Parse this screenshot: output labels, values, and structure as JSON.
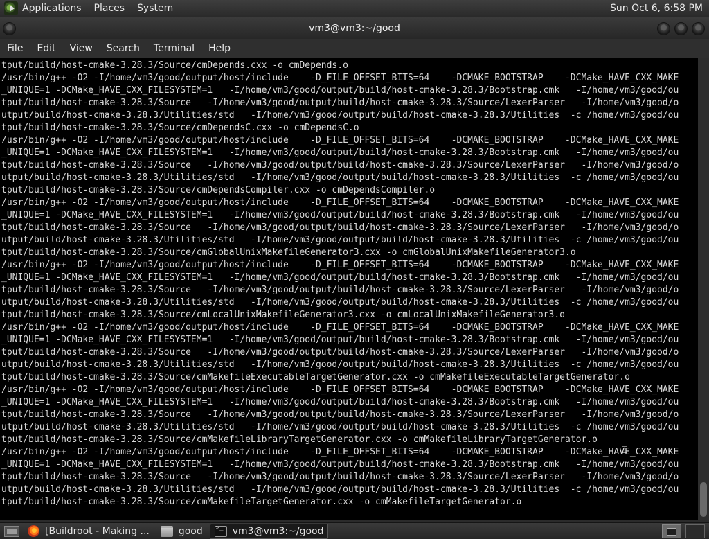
{
  "top_panel": {
    "menus": [
      "Applications",
      "Places",
      "System"
    ],
    "clock": "Sun Oct  6,  6:58 PM"
  },
  "window": {
    "title": "vm3@vm3:~/good"
  },
  "menubar": {
    "items": [
      "File",
      "Edit",
      "View",
      "Search",
      "Terminal",
      "Help"
    ]
  },
  "terminal": {
    "lines": [
      "tput/build/host-cmake-3.28.3/Source/cmDepends.cxx -o cmDepends.o",
      "/usr/bin/g++ -O2 -I/home/vm3/good/output/host/include    -D_FILE_OFFSET_BITS=64    -DCMAKE_BOOTSTRAP    -DCMake_HAVE_CXX_MAKE",
      "_UNIQUE=1 -DCMake_HAVE_CXX_FILESYSTEM=1   -I/home/vm3/good/output/build/host-cmake-3.28.3/Bootstrap.cmk   -I/home/vm3/good/ou",
      "tput/build/host-cmake-3.28.3/Source   -I/home/vm3/good/output/build/host-cmake-3.28.3/Source/LexerParser   -I/home/vm3/good/o",
      "utput/build/host-cmake-3.28.3/Utilities/std   -I/home/vm3/good/output/build/host-cmake-3.28.3/Utilities  -c /home/vm3/good/ou",
      "tput/build/host-cmake-3.28.3/Source/cmDependsC.cxx -o cmDependsC.o",
      "/usr/bin/g++ -O2 -I/home/vm3/good/output/host/include    -D_FILE_OFFSET_BITS=64    -DCMAKE_BOOTSTRAP    -DCMake_HAVE_CXX_MAKE",
      "_UNIQUE=1 -DCMake_HAVE_CXX_FILESYSTEM=1   -I/home/vm3/good/output/build/host-cmake-3.28.3/Bootstrap.cmk   -I/home/vm3/good/ou",
      "tput/build/host-cmake-3.28.3/Source   -I/home/vm3/good/output/build/host-cmake-3.28.3/Source/LexerParser   -I/home/vm3/good/o",
      "utput/build/host-cmake-3.28.3/Utilities/std   -I/home/vm3/good/output/build/host-cmake-3.28.3/Utilities  -c /home/vm3/good/ou",
      "tput/build/host-cmake-3.28.3/Source/cmDependsCompiler.cxx -o cmDependsCompiler.o",
      "/usr/bin/g++ -O2 -I/home/vm3/good/output/host/include    -D_FILE_OFFSET_BITS=64    -DCMAKE_BOOTSTRAP    -DCMake_HAVE_CXX_MAKE",
      "_UNIQUE=1 -DCMake_HAVE_CXX_FILESYSTEM=1   -I/home/vm3/good/output/build/host-cmake-3.28.3/Bootstrap.cmk   -I/home/vm3/good/ou",
      "tput/build/host-cmake-3.28.3/Source   -I/home/vm3/good/output/build/host-cmake-3.28.3/Source/LexerParser   -I/home/vm3/good/o",
      "utput/build/host-cmake-3.28.3/Utilities/std   -I/home/vm3/good/output/build/host-cmake-3.28.3/Utilities  -c /home/vm3/good/ou",
      "tput/build/host-cmake-3.28.3/Source/cmGlobalUnixMakefileGenerator3.cxx -o cmGlobalUnixMakefileGenerator3.o",
      "/usr/bin/g++ -O2 -I/home/vm3/good/output/host/include    -D_FILE_OFFSET_BITS=64    -DCMAKE_BOOTSTRAP    -DCMake_HAVE_CXX_MAKE",
      "_UNIQUE=1 -DCMake_HAVE_CXX_FILESYSTEM=1   -I/home/vm3/good/output/build/host-cmake-3.28.3/Bootstrap.cmk   -I/home/vm3/good/ou",
      "tput/build/host-cmake-3.28.3/Source   -I/home/vm3/good/output/build/host-cmake-3.28.3/Source/LexerParser   -I/home/vm3/good/o",
      "utput/build/host-cmake-3.28.3/Utilities/std   -I/home/vm3/good/output/build/host-cmake-3.28.3/Utilities  -c /home/vm3/good/ou",
      "tput/build/host-cmake-3.28.3/Source/cmLocalUnixMakefileGenerator3.cxx -o cmLocalUnixMakefileGenerator3.o",
      "/usr/bin/g++ -O2 -I/home/vm3/good/output/host/include    -D_FILE_OFFSET_BITS=64    -DCMAKE_BOOTSTRAP    -DCMake_HAVE_CXX_MAKE",
      "_UNIQUE=1 -DCMake_HAVE_CXX_FILESYSTEM=1   -I/home/vm3/good/output/build/host-cmake-3.28.3/Bootstrap.cmk   -I/home/vm3/good/ou",
      "tput/build/host-cmake-3.28.3/Source   -I/home/vm3/good/output/build/host-cmake-3.28.3/Source/LexerParser   -I/home/vm3/good/o",
      "utput/build/host-cmake-3.28.3/Utilities/std   -I/home/vm3/good/output/build/host-cmake-3.28.3/Utilities  -c /home/vm3/good/ou",
      "tput/build/host-cmake-3.28.3/Source/cmMakefileExecutableTargetGenerator.cxx -o cmMakefileExecutableTargetGenerator.o",
      "/usr/bin/g++ -O2 -I/home/vm3/good/output/host/include    -D_FILE_OFFSET_BITS=64    -DCMAKE_BOOTSTRAP    -DCMake_HAVE_CXX_MAKE",
      "_UNIQUE=1 -DCMake_HAVE_CXX_FILESYSTEM=1   -I/home/vm3/good/output/build/host-cmake-3.28.3/Bootstrap.cmk   -I/home/vm3/good/ou",
      "tput/build/host-cmake-3.28.3/Source   -I/home/vm3/good/output/build/host-cmake-3.28.3/Source/LexerParser   -I/home/vm3/good/o",
      "utput/build/host-cmake-3.28.3/Utilities/std   -I/home/vm3/good/output/build/host-cmake-3.28.3/Utilities  -c /home/vm3/good/ou",
      "tput/build/host-cmake-3.28.3/Source/cmMakefileLibraryTargetGenerator.cxx -o cmMakefileLibraryTargetGenerator.o",
      "/usr/bin/g++ -O2 -I/home/vm3/good/output/host/include    -D_FILE_OFFSET_BITS=64    -DCMAKE_BOOTSTRAP    -DCMake_HAVE_CXX_MAKE",
      "_UNIQUE=1 -DCMake_HAVE_CXX_FILESYSTEM=1   -I/home/vm3/good/output/build/host-cmake-3.28.3/Bootstrap.cmk   -I/home/vm3/good/ou",
      "tput/build/host-cmake-3.28.3/Source   -I/home/vm3/good/output/build/host-cmake-3.28.3/Source/LexerParser   -I/home/vm3/good/o",
      "utput/build/host-cmake-3.28.3/Utilities/std   -I/home/vm3/good/output/build/host-cmake-3.28.3/Utilities  -c /home/vm3/good/ou",
      "tput/build/host-cmake-3.28.3/Source/cmMakefileTargetGenerator.cxx -o cmMakefileTargetGenerator.o"
    ]
  },
  "taskbar": {
    "tasks": [
      {
        "label": "[Buildroot - Making ...",
        "icon": "firefox-icon"
      },
      {
        "label": "good",
        "icon": "folder-icon"
      },
      {
        "label": "vm3@vm3:~/good",
        "icon": "terminal-icon"
      }
    ]
  }
}
